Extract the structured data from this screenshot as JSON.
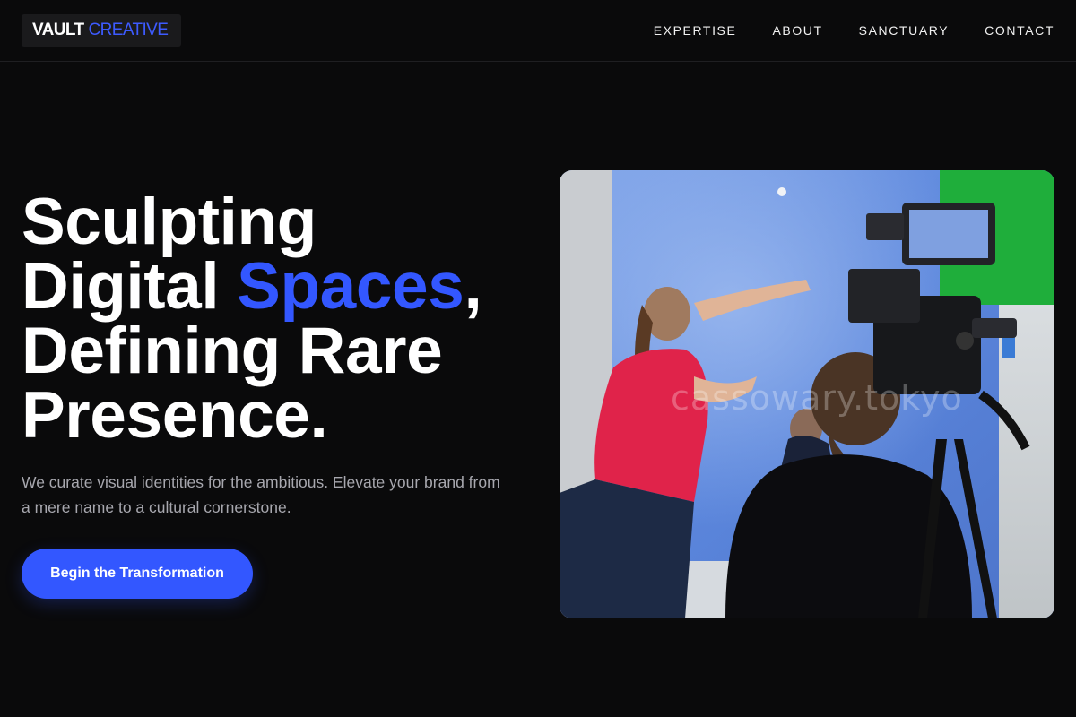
{
  "brand": {
    "name_primary": "VAULT",
    "name_secondary": "CREATIVE"
  },
  "nav": {
    "items": [
      {
        "label": "EXPERTISE"
      },
      {
        "label": "ABOUT"
      },
      {
        "label": "SANCTUARY"
      },
      {
        "label": "CONTACT"
      }
    ]
  },
  "hero": {
    "title_line1": "Sculpting",
    "title_line2_pre": "Digital ",
    "title_line2_accent": "Spaces",
    "title_line2_post": ",",
    "title_line3": "Defining Rare",
    "title_line4": "Presence.",
    "subtitle": "We curate visual identities for the ambitious. Elevate your brand from a mere name to a cultural cornerstone.",
    "cta_label": "Begin the Transformation"
  },
  "image": {
    "watermark": "cassowary.tokyo"
  },
  "colors": {
    "background": "#0a0a0b",
    "accent": "#3357ff",
    "text_muted": "#a7a7ae"
  }
}
